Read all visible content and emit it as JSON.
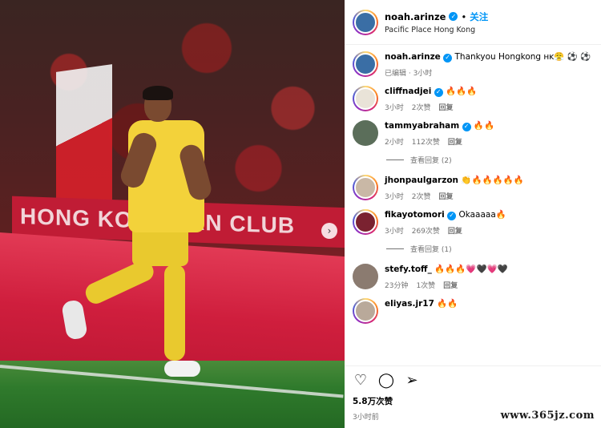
{
  "media": {
    "banner_text": "HONG KONG    FAN CLUB",
    "next_icon": "›"
  },
  "header": {
    "username": "noah.arinze",
    "verified_mark": "✓",
    "separator": "•",
    "follow_label": "关注",
    "location": "Pacific Place Hong Kong"
  },
  "caption": {
    "username": "noah.arinze",
    "text": "Thankyou Hongkong ʜᴋ😤 ⚽ ⚽",
    "edited": "已编辑 · 3小时"
  },
  "comments": [
    {
      "username": "cliffnadjei",
      "verified": true,
      "text": "🔥🔥🔥",
      "time": "3小时",
      "likes": "2次赞",
      "reply": "回复"
    },
    {
      "username": "tammyabraham",
      "verified": true,
      "text": "🔥🔥",
      "time": "2小时",
      "likes": "112次赞",
      "reply": "回复"
    },
    {
      "username": "jhonpaulgarzon",
      "verified": false,
      "text": "👏🔥🔥🔥🔥🔥",
      "time": "3小时",
      "likes": "2次赞",
      "reply": "回复"
    },
    {
      "username": "fikayotomori",
      "verified": true,
      "text": "Okaaaaa🔥",
      "time": "3小时",
      "likes": "269次赞",
      "reply": "回复"
    },
    {
      "username": "stefy.toff_",
      "verified": false,
      "text": "🔥🔥🔥💗🖤💗🖤",
      "time": "23分钟",
      "likes": "1次赞",
      "reply": "回复"
    },
    {
      "username": "eliyas.jr17",
      "verified": false,
      "text": "🔥🔥",
      "time": "",
      "likes": "",
      "reply": ""
    }
  ],
  "view_replies": [
    {
      "label": "查看回复 (2)"
    },
    {
      "label": "查看回复 (1)"
    }
  ],
  "actions": {
    "like_icon": "♡",
    "comment_icon": "◯",
    "share_icon": "➢",
    "likes_count": "5.8万次赞",
    "posted_time": "3小时前"
  },
  "watermark": "www.365jz.com",
  "colors": {
    "accent": "#0095f6",
    "muted": "#737373",
    "jersey": "#f3d23a",
    "board_red": "#cf1e3d"
  }
}
